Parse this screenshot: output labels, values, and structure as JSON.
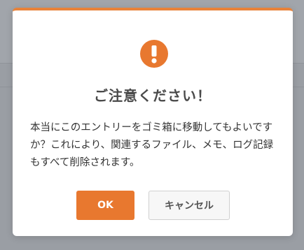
{
  "dialog": {
    "icon": "exclamation-circle-icon",
    "title": "ご注意ください！",
    "message": "本当にこのエントリーをゴミ箱に移動してもよいですか？これにより、関連するファイル、メモ、ログ記録もすべて削除されます。",
    "ok_label": "OK",
    "cancel_label": "キャンセル"
  },
  "colors": {
    "accent": "#e8782f",
    "overlay": "#9a9ea4"
  }
}
